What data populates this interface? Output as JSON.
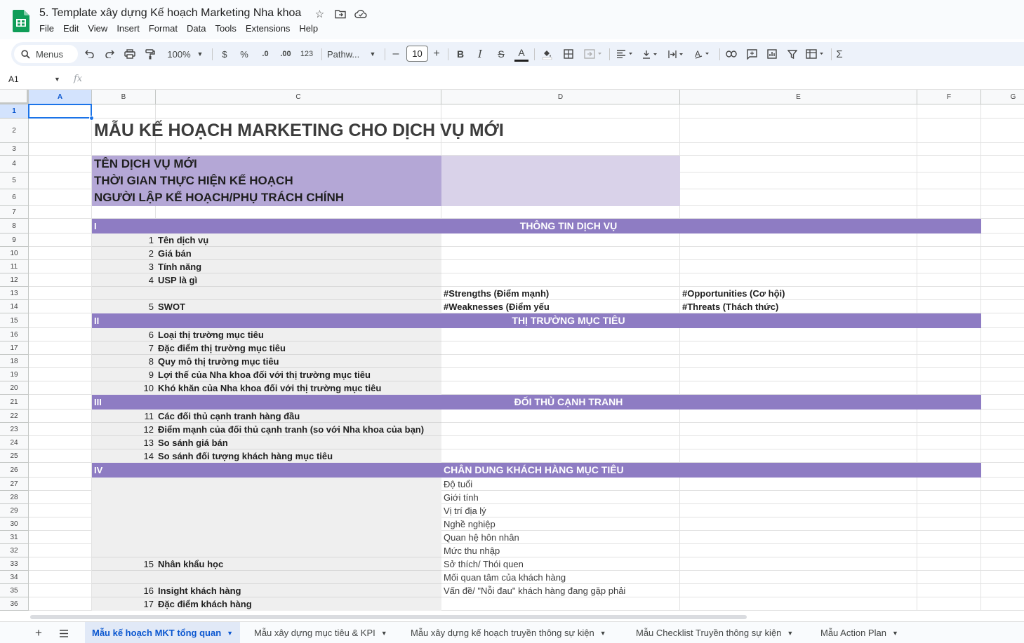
{
  "app": {
    "doc_title": "5. Template xây dựng Kế hoạch Marketing Nha khoa",
    "menu": [
      "File",
      "Edit",
      "View",
      "Insert",
      "Format",
      "Data",
      "Tools",
      "Extensions",
      "Help"
    ]
  },
  "toolbar": {
    "menus_label": "Menus",
    "zoom": "100%",
    "currency": "$",
    "percent": "%",
    "dec_less": ".0",
    "dec_more": ".00",
    "number_format": "123",
    "font": "Pathw...",
    "font_size": "10",
    "minus": "–",
    "plus": "+",
    "bold": "B",
    "italic": "I",
    "strike": "S",
    "text_color": "A",
    "sum": "Σ"
  },
  "formula_bar": {
    "cell_ref": "A1",
    "fx": "fx"
  },
  "columns": [
    "A",
    "B",
    "C",
    "D",
    "E",
    "F",
    "G"
  ],
  "rows": [
    "1",
    "2",
    "3",
    "4",
    "5",
    "6",
    "7",
    "8",
    "9",
    "10",
    "11",
    "12",
    "13",
    "14",
    "15",
    "16",
    "17",
    "18",
    "19",
    "20",
    "21",
    "22",
    "23",
    "24",
    "25",
    "26",
    "27",
    "28",
    "29",
    "30",
    "31",
    "32",
    "33",
    "34",
    "35",
    "36"
  ],
  "sheet": {
    "title": "MẪU KẾ HOẠCH MARKETING CHO DỊCH VỤ MỚI",
    "header_labels": [
      "TÊN DỊCH VỤ MỚI",
      "THỜI GIAN THỰC HIỆN KẾ HOẠCH",
      "NGƯỜI LẬP KẾ HOẠCH/PHỤ TRÁCH CHÍNH"
    ],
    "sections": [
      {
        "num": "I",
        "title": "THÔNG TIN DỊCH VỤ"
      },
      {
        "num": "II",
        "title": "THỊ TRƯỜNG MỤC TIÊU"
      },
      {
        "num": "III",
        "title": "ĐỐI THỦ CẠNH TRANH"
      },
      {
        "num": "IV",
        "title": "CHÂN DUNG KHÁCH HÀNG MỤC TIÊU"
      }
    ],
    "items": [
      {
        "n": "1",
        "label": "Tên dịch vụ"
      },
      {
        "n": "2",
        "label": "Giá bán"
      },
      {
        "n": "3",
        "label": "Tính năng"
      },
      {
        "n": "4",
        "label": "USP là gì"
      },
      {
        "n": "5",
        "label": "SWOT"
      },
      {
        "n": "6",
        "label": "Loại thị trường mục tiêu"
      },
      {
        "n": "7",
        "label": "Đặc điểm thị trường mục tiêu"
      },
      {
        "n": "8",
        "label": "Quy mô thị trường mục tiêu"
      },
      {
        "n": "9",
        "label": "Lợi thế của Nha khoa đối với thị trường mục tiêu"
      },
      {
        "n": "10",
        "label": "Khó khăn của Nha khoa đối với thị trường mục tiêu"
      },
      {
        "n": "11",
        "label": "Các đối thủ cạnh tranh hàng đầu"
      },
      {
        "n": "12",
        "label": "Điểm mạnh của đối thủ cạnh tranh (so với Nha khoa của bạn)"
      },
      {
        "n": "13",
        "label": "So sánh giá bán"
      },
      {
        "n": "14",
        "label": "So sánh đối tượng khách hàng mục tiêu"
      },
      {
        "n": "15",
        "label": "Nhân khẩu học"
      },
      {
        "n": "16",
        "label": "Insight khách hàng"
      },
      {
        "n": "17",
        "label": "Đặc điểm khách hàng"
      }
    ],
    "swot": {
      "strengths": "#Strengths (Điểm mạnh)",
      "weaknesses": "#Weaknesses (Điểm yếu",
      "opportunities": "#Opportunities (Cơ hội)",
      "threats": "#Threats (Thách thức)"
    },
    "demographics": [
      "Độ tuổi",
      "Giới tính",
      "Vị trí địa lý",
      "Nghề nghiệp",
      "Quan hệ hôn nhân",
      "Mức thu nhập",
      "Sở thích/ Thói quen",
      "Mối quan tâm của khách hàng",
      "Vấn đề/ \"Nỗi đau\" khách hàng đang gặp phải"
    ]
  },
  "tabs": [
    {
      "label": "Mẫu kế hoạch MKT tổng quan",
      "active": true
    },
    {
      "label": "Mẫu xây dựng mục tiêu & KPI",
      "active": false
    },
    {
      "label": "Mẫu xây dựng kế hoạch truyền thông sự kiện",
      "active": false
    },
    {
      "label": "Mẫu Checklist Truyền thông sự kiện",
      "active": false
    },
    {
      "label": "Mẫu Action Plan",
      "active": false
    }
  ],
  "colors": {
    "section_band": "#8e7cc3",
    "label_purple": "#b4a7d6",
    "light_purple": "#d9d2e9",
    "grey_cell": "#efefef",
    "selection": "#1a73e8"
  }
}
